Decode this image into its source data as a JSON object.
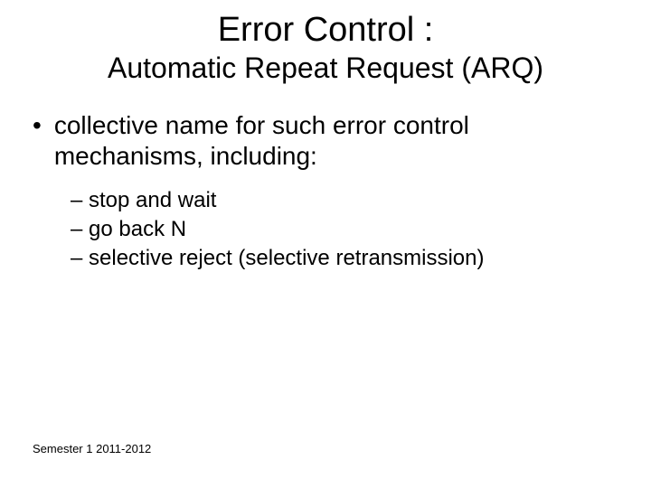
{
  "title": "Error Control :",
  "subtitle": "Automatic Repeat Request (ARQ)",
  "main_bullet": "collective name for such error control mechanisms, including:",
  "sub_bullets": [
    "– stop and wait",
    "– go back N",
    "– selective reject (selective retransmission)"
  ],
  "footer": "Semester 1 2011-2012"
}
